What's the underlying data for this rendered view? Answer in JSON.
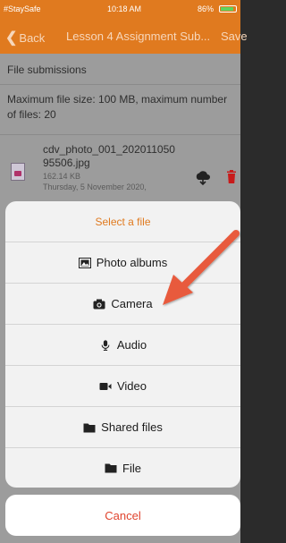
{
  "status_bar": {
    "carrier": "#StaySafe",
    "time": "10:18 AM",
    "battery": "86%"
  },
  "nav": {
    "back_label": "Back",
    "title": "Lesson 4 Assignment Sub...",
    "save_label": "Save"
  },
  "page": {
    "section_label": "File submissions",
    "max_size_text": "Maximum file size: 100 MB, maximum number of files: 20",
    "file": {
      "name": "cdv_photo_001_202011050 95506.jpg",
      "size": "162.14 KB",
      "date": "Thursday, 5 November 2020,"
    }
  },
  "sheet": {
    "title": "Select a file",
    "items": [
      {
        "label": "Photo albums",
        "icon": "photo-albums-icon"
      },
      {
        "label": "Camera",
        "icon": "camera-icon"
      },
      {
        "label": "Audio",
        "icon": "microphone-icon"
      },
      {
        "label": "Video",
        "icon": "video-camera-icon"
      },
      {
        "label": "Shared files",
        "icon": "folder-icon"
      },
      {
        "label": "File",
        "icon": "folder-icon"
      }
    ],
    "cancel_label": "Cancel"
  },
  "colors": {
    "accent": "#e07a1f",
    "cancel": "#e0442e",
    "arrow": "#e85a3c"
  }
}
